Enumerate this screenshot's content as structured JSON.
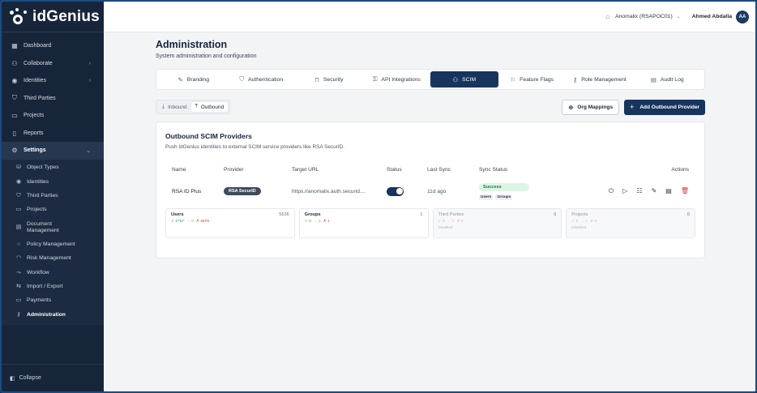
{
  "app": {
    "name": "idGenius"
  },
  "sidebar": {
    "items": [
      {
        "label": "Dashboard",
        "icon": "grid-icon"
      },
      {
        "label": "Collaborate",
        "icon": "users-icon",
        "chevron": "›"
      },
      {
        "label": "Identities",
        "icon": "identity-icon",
        "chevron": "›"
      },
      {
        "label": "Third Parties",
        "icon": "shield-icon"
      },
      {
        "label": "Projects",
        "icon": "folder-icon"
      },
      {
        "label": "Reports",
        "icon": "file-icon"
      },
      {
        "label": "Settings",
        "icon": "gear-icon",
        "chevron": "⌄"
      }
    ],
    "settings_items": [
      {
        "label": "Object Types",
        "icon": "database-icon"
      },
      {
        "label": "Identities",
        "icon": "identity-icon"
      },
      {
        "label": "Third Parties",
        "icon": "shield-icon"
      },
      {
        "label": "Projects",
        "icon": "folder-icon"
      },
      {
        "label": "Document Management",
        "icon": "document-icon"
      },
      {
        "label": "Policy Management",
        "icon": "circle-icon"
      },
      {
        "label": "Risk Management",
        "icon": "gauge-icon"
      },
      {
        "label": "Workflow",
        "icon": "workflow-icon"
      },
      {
        "label": "Import / Export",
        "icon": "import-export-icon"
      },
      {
        "label": "Payments",
        "icon": "card-icon"
      },
      {
        "label": "Administration",
        "icon": "admin-icon"
      }
    ],
    "collapse_label": "Collapse"
  },
  "topbar": {
    "org": "Anomalix (RSAPOC01)",
    "user_name": "Ahmed Abdalla",
    "user_initials": "AA"
  },
  "page": {
    "title": "Administration",
    "subtitle": "System administration and configuration"
  },
  "tabs": [
    {
      "label": "Branding",
      "icon": "brush-icon"
    },
    {
      "label": "Authentication",
      "icon": "shield-icon"
    },
    {
      "label": "Security",
      "icon": "lock-icon"
    },
    {
      "label": "API Integrations",
      "icon": "key-icon"
    },
    {
      "label": "SCIM",
      "icon": "users-icon",
      "active": true
    },
    {
      "label": "Feature Flags",
      "icon": "flag-icon"
    },
    {
      "label": "Role Management",
      "icon": "user-key-icon"
    },
    {
      "label": "Audit Log",
      "icon": "log-icon"
    }
  ],
  "scim": {
    "inbound_label": "Inbound",
    "outbound_label": "Outbound",
    "org_mappings_label": "Org Mappings",
    "add_provider_label": "Add Outbound Provider"
  },
  "card": {
    "title": "Outbound SCIM Providers",
    "subtitle": "Push IdGenius identities to external SCIM service providers like RSA SecurID."
  },
  "table": {
    "headers": {
      "name": "Name",
      "provider": "Provider",
      "target_url": "Target URL",
      "status": "Status",
      "last_sync": "Last Sync",
      "sync_status": "Sync Status",
      "actions": "Actions"
    },
    "row": {
      "name": "RSA ID Plus",
      "provider": "RSA SecurID",
      "target_url": "https://anomalix.auth.securid....",
      "enabled": true,
      "last_sync": "11d ago",
      "sync_status": "Success",
      "sync_tags": [
        "Users",
        "Groups"
      ]
    }
  },
  "stats": [
    {
      "label": "Users",
      "count": "5636",
      "ok": "✓ 2757",
      "skip": "→ 0",
      "fail": "✗ 2879",
      "enabled": true,
      "note": ""
    },
    {
      "label": "Groups",
      "count": "1",
      "ok": "✓ 0",
      "skip": "→ 0",
      "fail": "✗ 1",
      "enabled": true,
      "note": ""
    },
    {
      "label": "Third Parties",
      "count": "0",
      "ok": "✓ 0",
      "skip": "→ 0",
      "fail": "✗ 0",
      "enabled": false,
      "note": "Disabled"
    },
    {
      "label": "Projects",
      "count": "0",
      "ok": "✓ 0",
      "skip": "→ 0",
      "fail": "✗ 0",
      "enabled": false,
      "note": "Disabled"
    }
  ],
  "colors": {
    "sidebar_bg": "#17253a",
    "primary": "#17345d",
    "success_bg": "#dcf5e4",
    "success_text": "#17803d",
    "danger": "#d43a3a"
  }
}
